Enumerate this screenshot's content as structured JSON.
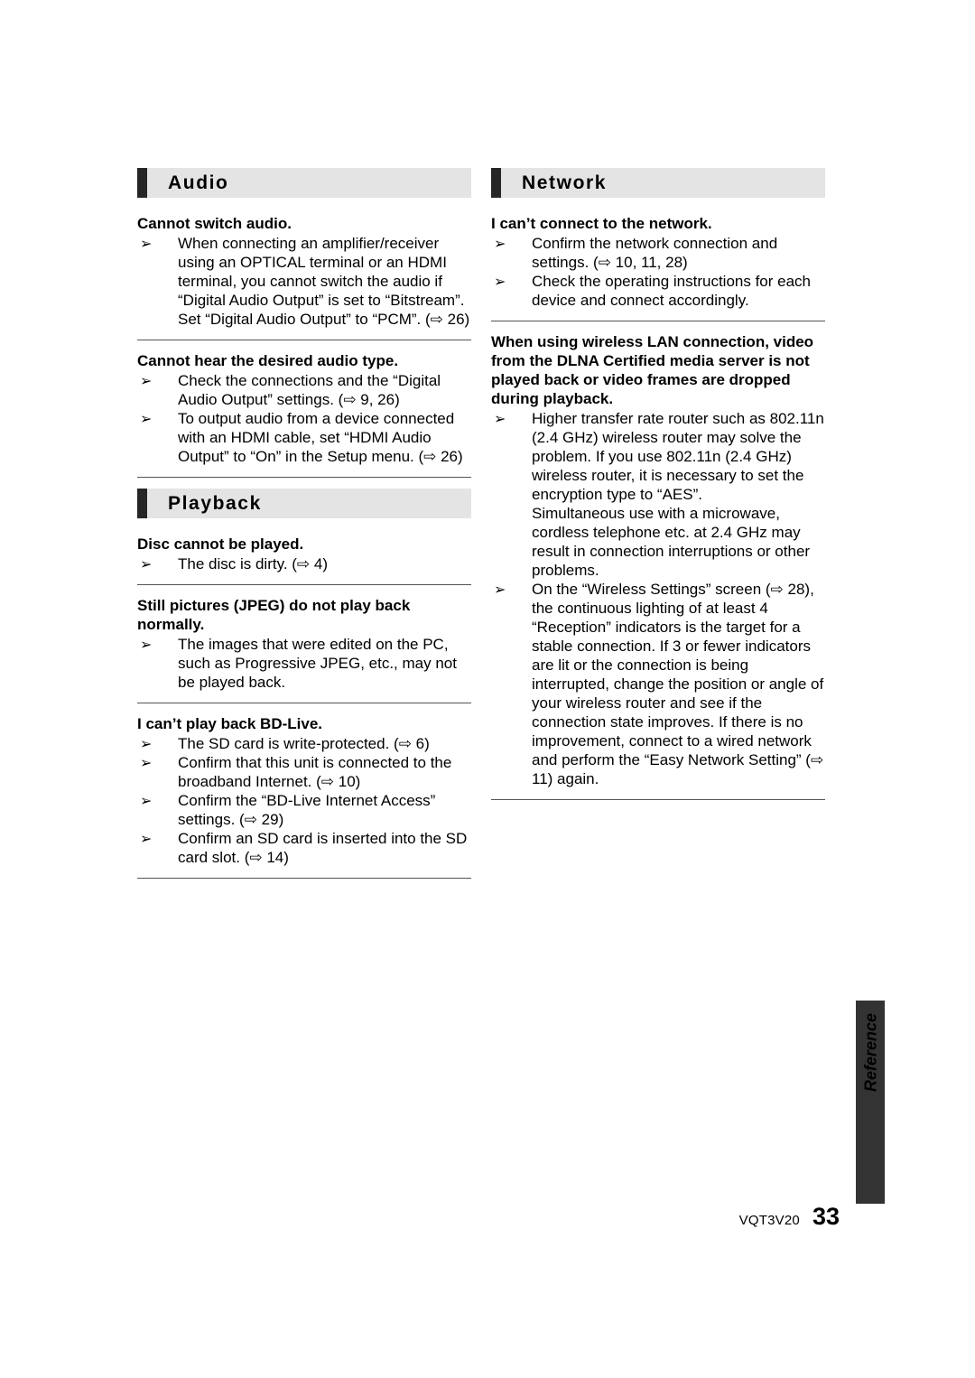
{
  "page": {
    "number": "33",
    "doc_code": "VQT3V20",
    "side_tab_label": "Reference"
  },
  "glyphs": {
    "bullet": "➢",
    "ref_arrow": "⇨"
  },
  "columns": {
    "left": [
      {
        "type": "header",
        "title": "Audio"
      },
      {
        "type": "block",
        "question": "Cannot switch audio.",
        "items": [
          "When connecting an amplifier/receiver using an OPTICAL terminal or an HDMI terminal, you cannot switch the audio if “Digital Audio Output” is set to “Bitstream”. Set “Digital Audio Output” to “PCM”. (⇨ 26)"
        ]
      },
      {
        "type": "rule"
      },
      {
        "type": "block",
        "question": "Cannot hear the desired audio type.",
        "items": [
          "Check the connections and the “Digital Audio Output” settings. (⇨ 9, 26)",
          "To output audio from a device connected with an HDMI cable, set “HDMI Audio Output” to “On” in the Setup menu. (⇨ 26)"
        ]
      },
      {
        "type": "rule"
      },
      {
        "type": "header",
        "title": "Playback"
      },
      {
        "type": "block",
        "question": "Disc cannot be played.",
        "items": [
          "The disc is dirty. (⇨ 4)"
        ]
      },
      {
        "type": "rule"
      },
      {
        "type": "block",
        "question": "Still pictures (JPEG) do not play back normally.",
        "items": [
          "The images that were edited on the PC, such as Progressive JPEG, etc., may not be played back."
        ]
      },
      {
        "type": "rule"
      },
      {
        "type": "block",
        "question": "I can’t play back BD-Live.",
        "items": [
          "The SD card is write-protected. (⇨ 6)",
          "Confirm that this unit is connected to the broadband Internet. (⇨ 10)",
          "Confirm the “BD-Live Internet Access” settings. (⇨ 29)",
          "Confirm an SD card is inserted into the SD card slot. (⇨ 14)"
        ]
      },
      {
        "type": "rule"
      }
    ],
    "right": [
      {
        "type": "header",
        "title": "Network"
      },
      {
        "type": "block",
        "question": "I can’t connect to the network.",
        "items": [
          "Confirm the network connection and settings. (⇨ 10, 11, 28)",
          "Check the operating instructions for each device and connect accordingly."
        ]
      },
      {
        "type": "rule"
      },
      {
        "type": "block",
        "question": "When using wireless LAN connection, video from the DLNA Certified media server is not played back or video frames are dropped during playback.",
        "items": [
          "Higher transfer rate router such as 802.11n (2.4 GHz) wireless router may solve the problem. If you use 802.11n (2.4 GHz) wireless router, it is necessary to set the encryption type to “AES”.\nSimultaneous use with a microwave, cordless telephone etc. at 2.4 GHz may result in connection interruptions or other problems.",
          "On the “Wireless Settings” screen (⇨ 28), the continuous lighting of at least 4 “Reception” indicators is the target for a stable connection. If 3 or fewer indicators are lit or the connection is being interrupted, change the position or angle of your wireless router and see if the connection state improves. If there is no improvement, connect to a wired network and perform the “Easy Network Setting” (⇨ 11) again."
        ]
      },
      {
        "type": "rule"
      }
    ]
  }
}
